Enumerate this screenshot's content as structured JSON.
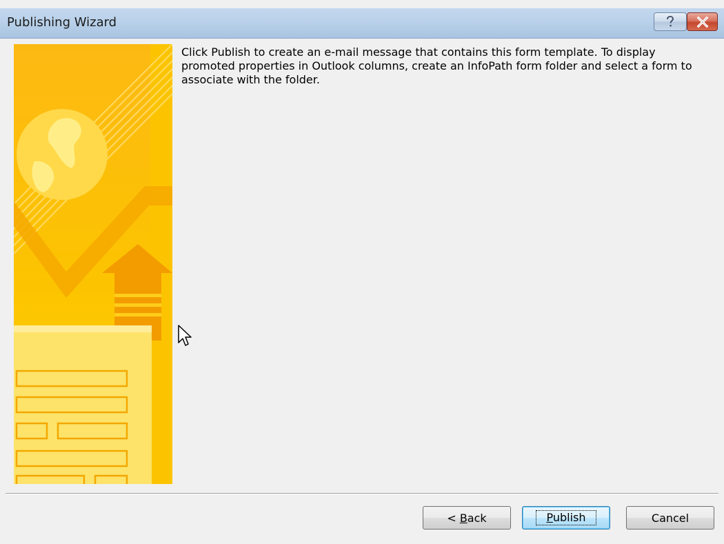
{
  "window": {
    "title": "Publishing Wizard",
    "help_glyph": "?",
    "close_glyph": "x"
  },
  "content": {
    "instructions": "Click Publish to create an e-mail message that contains this form template. To display promoted properties in Outlook columns, create an InfoPath form folder and select a form to associate with the folder."
  },
  "buttons": {
    "back": {
      "label": "< Back",
      "mnemonic": "B"
    },
    "publish": {
      "label": "Publish",
      "mnemonic": "P"
    },
    "cancel": {
      "label": "Cancel"
    }
  },
  "colors": {
    "titlebar": "#b9d1ea",
    "graphic_base": "#fcc800",
    "graphic_light": "#ffe56a",
    "graphic_dark": "#f6a800",
    "close_button": "#c5482f"
  },
  "icons": {
    "help": "question-mark-icon",
    "close": "close-x-icon",
    "cursor": "mouse-pointer-icon",
    "graphic": "publishing-wizard-banner"
  }
}
